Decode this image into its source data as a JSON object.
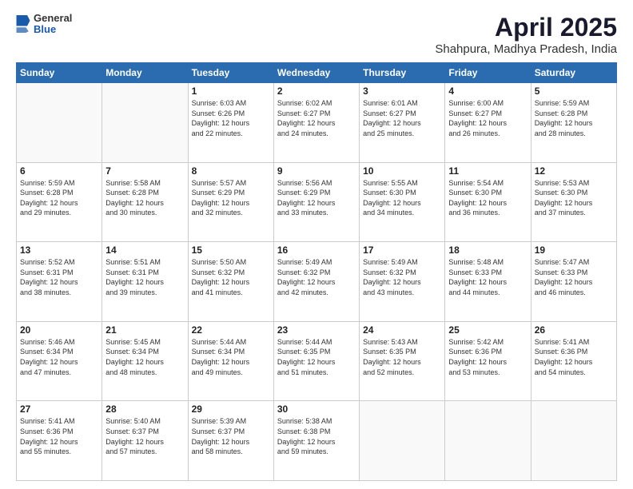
{
  "logo": {
    "general": "General",
    "blue": "Blue"
  },
  "header": {
    "month": "April 2025",
    "location": "Shahpura, Madhya Pradesh, India"
  },
  "days": [
    "Sunday",
    "Monday",
    "Tuesday",
    "Wednesday",
    "Thursday",
    "Friday",
    "Saturday"
  ],
  "weeks": [
    [
      {
        "day": "",
        "info": ""
      },
      {
        "day": "",
        "info": ""
      },
      {
        "day": "1",
        "info": "Sunrise: 6:03 AM\nSunset: 6:26 PM\nDaylight: 12 hours\nand 22 minutes."
      },
      {
        "day": "2",
        "info": "Sunrise: 6:02 AM\nSunset: 6:27 PM\nDaylight: 12 hours\nand 24 minutes."
      },
      {
        "day": "3",
        "info": "Sunrise: 6:01 AM\nSunset: 6:27 PM\nDaylight: 12 hours\nand 25 minutes."
      },
      {
        "day": "4",
        "info": "Sunrise: 6:00 AM\nSunset: 6:27 PM\nDaylight: 12 hours\nand 26 minutes."
      },
      {
        "day": "5",
        "info": "Sunrise: 5:59 AM\nSunset: 6:28 PM\nDaylight: 12 hours\nand 28 minutes."
      }
    ],
    [
      {
        "day": "6",
        "info": "Sunrise: 5:59 AM\nSunset: 6:28 PM\nDaylight: 12 hours\nand 29 minutes."
      },
      {
        "day": "7",
        "info": "Sunrise: 5:58 AM\nSunset: 6:28 PM\nDaylight: 12 hours\nand 30 minutes."
      },
      {
        "day": "8",
        "info": "Sunrise: 5:57 AM\nSunset: 6:29 PM\nDaylight: 12 hours\nand 32 minutes."
      },
      {
        "day": "9",
        "info": "Sunrise: 5:56 AM\nSunset: 6:29 PM\nDaylight: 12 hours\nand 33 minutes."
      },
      {
        "day": "10",
        "info": "Sunrise: 5:55 AM\nSunset: 6:30 PM\nDaylight: 12 hours\nand 34 minutes."
      },
      {
        "day": "11",
        "info": "Sunrise: 5:54 AM\nSunset: 6:30 PM\nDaylight: 12 hours\nand 36 minutes."
      },
      {
        "day": "12",
        "info": "Sunrise: 5:53 AM\nSunset: 6:30 PM\nDaylight: 12 hours\nand 37 minutes."
      }
    ],
    [
      {
        "day": "13",
        "info": "Sunrise: 5:52 AM\nSunset: 6:31 PM\nDaylight: 12 hours\nand 38 minutes."
      },
      {
        "day": "14",
        "info": "Sunrise: 5:51 AM\nSunset: 6:31 PM\nDaylight: 12 hours\nand 39 minutes."
      },
      {
        "day": "15",
        "info": "Sunrise: 5:50 AM\nSunset: 6:32 PM\nDaylight: 12 hours\nand 41 minutes."
      },
      {
        "day": "16",
        "info": "Sunrise: 5:49 AM\nSunset: 6:32 PM\nDaylight: 12 hours\nand 42 minutes."
      },
      {
        "day": "17",
        "info": "Sunrise: 5:49 AM\nSunset: 6:32 PM\nDaylight: 12 hours\nand 43 minutes."
      },
      {
        "day": "18",
        "info": "Sunrise: 5:48 AM\nSunset: 6:33 PM\nDaylight: 12 hours\nand 44 minutes."
      },
      {
        "day": "19",
        "info": "Sunrise: 5:47 AM\nSunset: 6:33 PM\nDaylight: 12 hours\nand 46 minutes."
      }
    ],
    [
      {
        "day": "20",
        "info": "Sunrise: 5:46 AM\nSunset: 6:34 PM\nDaylight: 12 hours\nand 47 minutes."
      },
      {
        "day": "21",
        "info": "Sunrise: 5:45 AM\nSunset: 6:34 PM\nDaylight: 12 hours\nand 48 minutes."
      },
      {
        "day": "22",
        "info": "Sunrise: 5:44 AM\nSunset: 6:34 PM\nDaylight: 12 hours\nand 49 minutes."
      },
      {
        "day": "23",
        "info": "Sunrise: 5:44 AM\nSunset: 6:35 PM\nDaylight: 12 hours\nand 51 minutes."
      },
      {
        "day": "24",
        "info": "Sunrise: 5:43 AM\nSunset: 6:35 PM\nDaylight: 12 hours\nand 52 minutes."
      },
      {
        "day": "25",
        "info": "Sunrise: 5:42 AM\nSunset: 6:36 PM\nDaylight: 12 hours\nand 53 minutes."
      },
      {
        "day": "26",
        "info": "Sunrise: 5:41 AM\nSunset: 6:36 PM\nDaylight: 12 hours\nand 54 minutes."
      }
    ],
    [
      {
        "day": "27",
        "info": "Sunrise: 5:41 AM\nSunset: 6:36 PM\nDaylight: 12 hours\nand 55 minutes."
      },
      {
        "day": "28",
        "info": "Sunrise: 5:40 AM\nSunset: 6:37 PM\nDaylight: 12 hours\nand 57 minutes."
      },
      {
        "day": "29",
        "info": "Sunrise: 5:39 AM\nSunset: 6:37 PM\nDaylight: 12 hours\nand 58 minutes."
      },
      {
        "day": "30",
        "info": "Sunrise: 5:38 AM\nSunset: 6:38 PM\nDaylight: 12 hours\nand 59 minutes."
      },
      {
        "day": "",
        "info": ""
      },
      {
        "day": "",
        "info": ""
      },
      {
        "day": "",
        "info": ""
      }
    ]
  ]
}
